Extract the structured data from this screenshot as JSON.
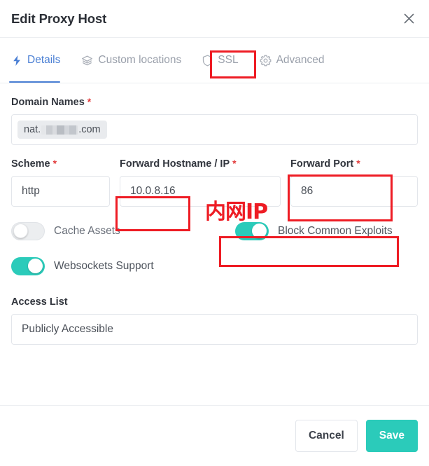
{
  "header": {
    "title": "Edit Proxy Host",
    "close_label": "×"
  },
  "tabs": [
    {
      "label": "Details",
      "icon": "zap-icon",
      "active": true
    },
    {
      "label": "Custom locations",
      "icon": "layers-icon",
      "active": false
    },
    {
      "label": "SSL",
      "icon": "shield-icon",
      "active": false
    },
    {
      "label": "Advanced",
      "icon": "gear-icon",
      "active": false
    }
  ],
  "form": {
    "domain_names": {
      "label": "Domain Names",
      "required_marker": "*",
      "tag_prefix": "nat.",
      "tag_suffix": ".com"
    },
    "scheme": {
      "label": "Scheme",
      "required_marker": "*",
      "value": "http"
    },
    "forward_hostname": {
      "label": "Forward Hostname / IP",
      "required_marker": "*",
      "value": "10.0.8.16"
    },
    "forward_port": {
      "label": "Forward Port",
      "required_marker": "*",
      "value": "86"
    },
    "cache_assets": {
      "label": "Cache Assets",
      "state": "off"
    },
    "block_common_exploits": {
      "label": "Block Common Exploits",
      "state": "on"
    },
    "websockets_support": {
      "label": "Websockets Support",
      "state": "on"
    },
    "access_list": {
      "label": "Access List",
      "value": "Publicly Accessible"
    }
  },
  "footer": {
    "cancel_label": "Cancel",
    "save_label": "Save"
  },
  "annotations": {
    "internal_ip_note": "内网IP",
    "color": "#ee1c24"
  },
  "colors": {
    "accent_teal": "#2bcbba",
    "active_tab_blue": "#4a7fd4",
    "required_red": "#e23b3b",
    "annotation_red": "#ee1c24"
  }
}
